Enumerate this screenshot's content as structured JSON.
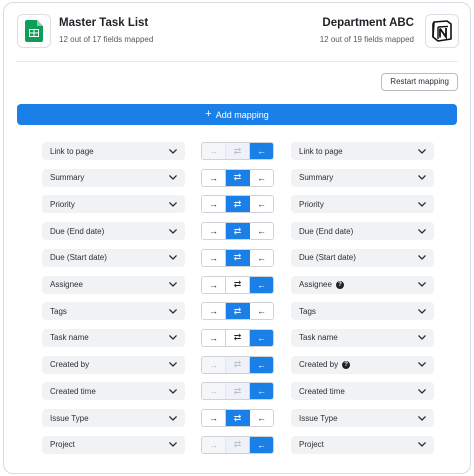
{
  "source": {
    "title": "Master Task List",
    "subtitle": "12 out of 17 fields mapped",
    "icon": "google-sheets-icon"
  },
  "destination": {
    "title": "Department ABC",
    "subtitle": "12 out of 19 fields mapped",
    "icon": "notion-icon"
  },
  "restart_label": "Restart mapping",
  "add_mapping_label": "Add mapping",
  "colors": {
    "accent": "#1b7fe8",
    "sheets_green": "#0f9d58",
    "field_bg": "#f1f2f4"
  },
  "rows": [
    {
      "left": "Link to page",
      "right": "Link to page",
      "direction": "right-to-left",
      "state": "left-only"
    },
    {
      "left": "Summary",
      "right": "Summary",
      "direction": "both",
      "state": "all"
    },
    {
      "left": "Priority",
      "right": "Priority",
      "direction": "both",
      "state": "all"
    },
    {
      "left": "Due (End date)",
      "right": "Due (End date)",
      "direction": "both",
      "state": "all"
    },
    {
      "left": "Due (Start date)",
      "right": "Due (Start date)",
      "direction": "both",
      "state": "all"
    },
    {
      "left": "Assignee",
      "right": "Assignee",
      "direction": "right-to-left",
      "state": "all",
      "right_help": true
    },
    {
      "left": "Tags",
      "right": "Tags",
      "direction": "both",
      "state": "all"
    },
    {
      "left": "Task name",
      "right": "Task name",
      "direction": "right-to-left",
      "state": "all"
    },
    {
      "left": "Created by",
      "right": "Created by",
      "direction": "right-to-left",
      "state": "left-only",
      "right_help": true
    },
    {
      "left": "Created time",
      "right": "Created time",
      "direction": "right-to-left",
      "state": "left-only"
    },
    {
      "left": "Issue Type",
      "right": "Issue Type",
      "direction": "both",
      "state": "all"
    },
    {
      "left": "Project",
      "right": "Project",
      "direction": "right-to-left",
      "state": "left-only"
    }
  ],
  "arrows": {
    "to_right": "→",
    "both": "⇄",
    "to_left": "←"
  }
}
